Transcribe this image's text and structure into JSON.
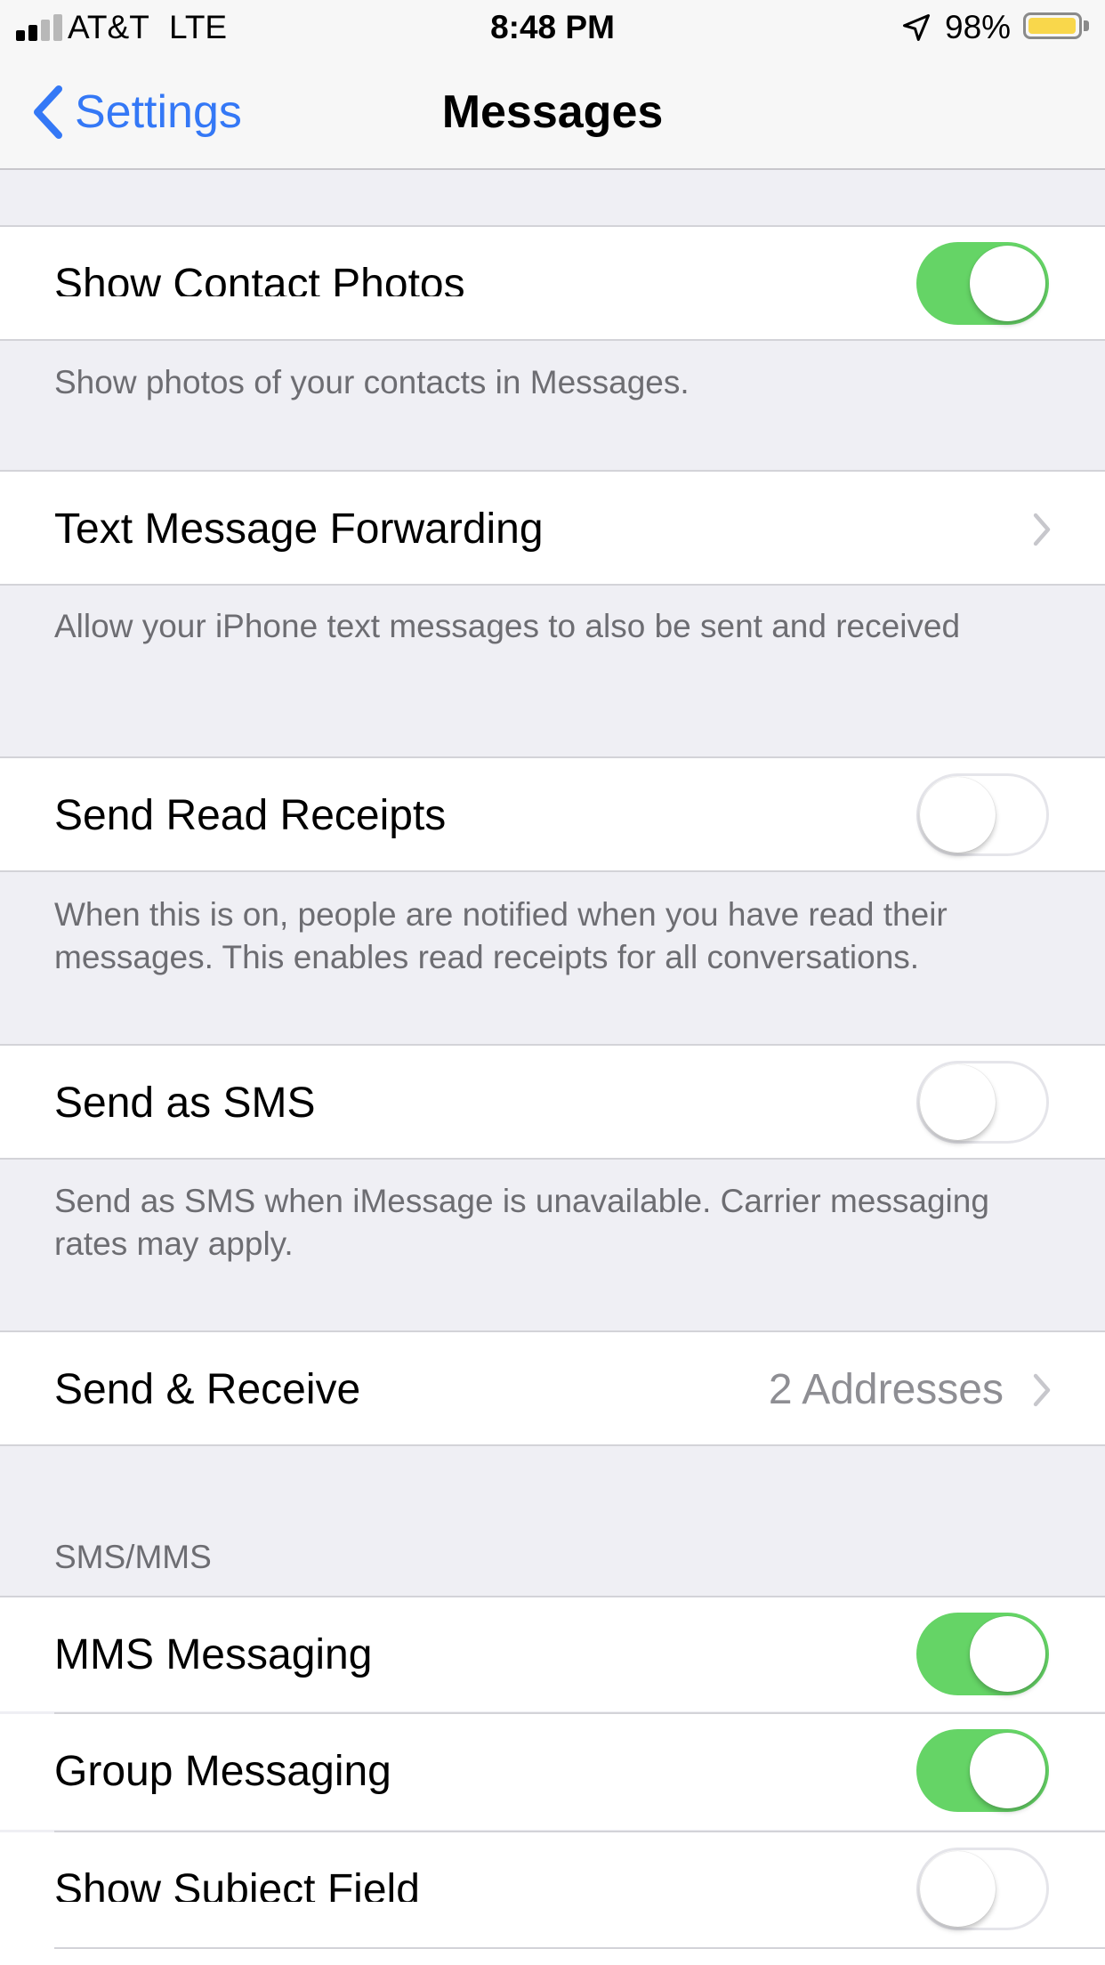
{
  "status_bar": {
    "carrier": "AT&T",
    "network": "LTE",
    "time": "8:48 PM",
    "battery_percent": "98%",
    "battery_level": 0.98,
    "battery_color": "#F9D74B",
    "signal_bars_filled": 2,
    "signal_bars_total": 4
  },
  "nav": {
    "back_label": "Settings",
    "title": "Messages",
    "accent_color": "#3478F6"
  },
  "rows": {
    "show_contact_photos": {
      "label": "Show Contact Photos",
      "on": true
    },
    "show_contact_photos_footer": "Show photos of your contacts in Messages.",
    "text_message_forwarding": {
      "label": "Text Message Forwarding"
    },
    "text_message_forwarding_footer": "Allow your iPhone text messages to also be sent and received",
    "send_read_receipts": {
      "label": "Send Read Receipts",
      "on": false
    },
    "send_read_receipts_footer": "When this is on, people are notified when you have read their messages. This enables read receipts for all conversations.",
    "send_as_sms": {
      "label": "Send as SMS",
      "on": false
    },
    "send_as_sms_footer": "Send as SMS when iMessage is unavailable. Carrier messaging rates may apply.",
    "send_receive": {
      "label": "Send & Receive",
      "detail": "2 Addresses"
    }
  },
  "sms_mms": {
    "header": "SMS/MMS",
    "mms_messaging": {
      "label": "MMS Messaging",
      "on": true
    },
    "group_messaging": {
      "label": "Group Messaging",
      "on": true
    },
    "show_subject_field": {
      "label": "Show Subject Field",
      "on": false
    }
  },
  "colors": {
    "toggle_on": "#65D466",
    "background": "#EFEFF4"
  }
}
